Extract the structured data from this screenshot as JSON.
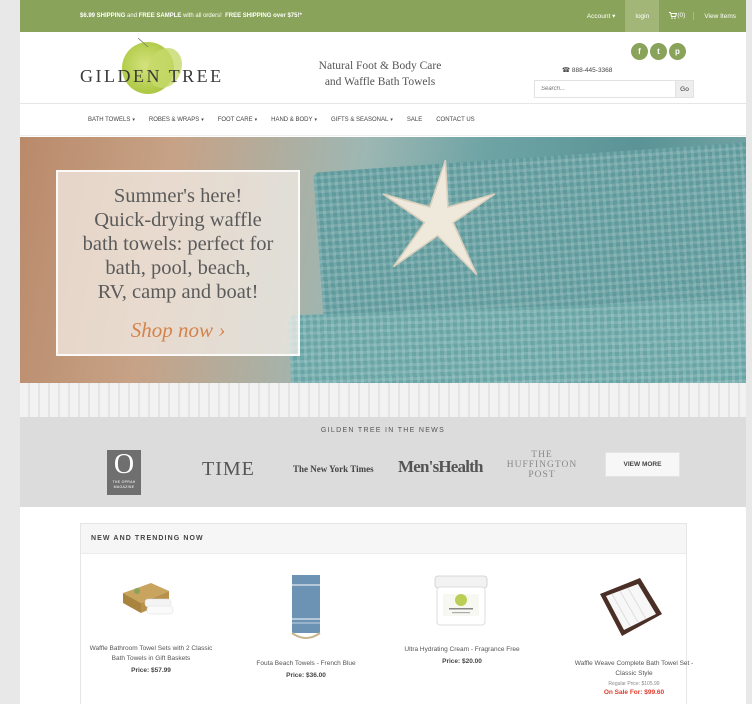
{
  "topbar": {
    "promo_1": "$6.99 SHIPPING",
    "promo_2": "and",
    "promo_3": "FREE SAMPLE",
    "promo_4": "with all orders!",
    "promo_5": "FREE SHIPPING over $75!*",
    "account": "Account",
    "login": "login",
    "cart": "(0)",
    "view_items": "View Items"
  },
  "header": {
    "logo_text": "GILDEN TREE",
    "tagline_1": "Natural Foot & Body Care",
    "tagline_2": "and Waffle Bath Towels",
    "social": [
      "f",
      "t",
      "p"
    ],
    "social_icons": [
      "facebook-icon",
      "twitter-icon",
      "pinterest-icon"
    ],
    "phone": "888-445-3368",
    "search_placeholder": "Search...",
    "search_button": "Go"
  },
  "nav": {
    "items": [
      {
        "label": "BATH TOWELS",
        "dropdown": true
      },
      {
        "label": "ROBES & WRAPS",
        "dropdown": true
      },
      {
        "label": "FOOT CARE",
        "dropdown": true
      },
      {
        "label": "HAND & BODY",
        "dropdown": true
      },
      {
        "label": "GIFTS & SEASONAL",
        "dropdown": true
      },
      {
        "label": "SALE",
        "dropdown": false
      },
      {
        "label": "CONTACT US",
        "dropdown": false
      }
    ]
  },
  "hero": {
    "headline_lines": [
      "Summer's here!",
      "Quick-drying waffle",
      "bath towels: perfect for",
      "bath, pool, beach,",
      "RV, camp and boat!"
    ],
    "cta": "Shop now ›"
  },
  "press": {
    "title": "GILDEN TREE IN THE NEWS",
    "oprah_letter": "O",
    "oprah_sub": "THE OPRAH MAGAZINE",
    "time": "TIME",
    "nyt": "The New York Times",
    "mens_health": "Men'sHealth",
    "huffington": [
      "THE",
      "HUFFINGTON",
      "POST"
    ],
    "view_more": "VIEW MORE"
  },
  "trending": {
    "title": "NEW AND TRENDING NOW",
    "products": [
      {
        "name": "Waffle Bathroom Towel Sets with 2 Classic Bath Towels in Gift Baskets",
        "price": "Price: $57.99"
      },
      {
        "name": "Fouta Beach Towels - French Blue",
        "price": "Price: $36.00"
      },
      {
        "name": "Ultra Hydrating Cream - Fragrance Free",
        "price": "Price: $20.00"
      },
      {
        "name": "Waffle Weave Complete Bath Towel Set - Classic Style",
        "regular_price": "Regular Price: $105.99",
        "sale_price": "On Sale For: $99.60"
      }
    ]
  },
  "colors": {
    "brand_green": "#8aa35a",
    "sale_red": "#e03b2a",
    "cta_orange": "#d4834a"
  }
}
